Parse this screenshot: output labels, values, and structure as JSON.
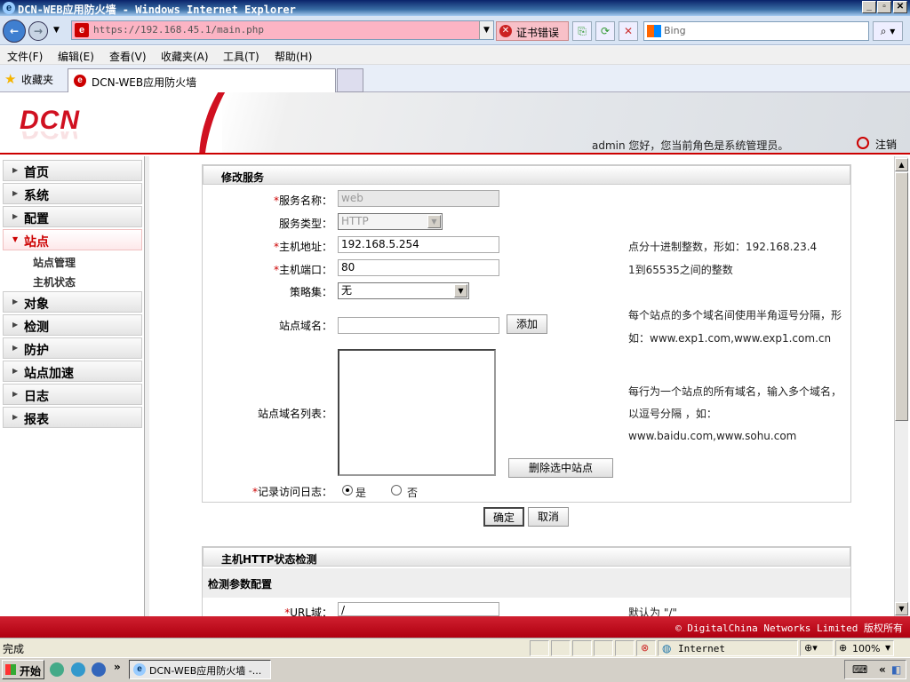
{
  "browser": {
    "window_title": "DCN-WEB应用防火墙 - Windows Internet Explorer",
    "address": "https://192.168.45.1/main.php",
    "cert_error": "证书错误",
    "search_placeholder": "Bing",
    "menu": [
      "文件(F)",
      "编辑(E)",
      "查看(V)",
      "收藏夹(A)",
      "工具(T)",
      "帮助(H)"
    ],
    "favorites_label": "收藏夹",
    "tab_title": "DCN-WEB应用防火墙",
    "status_text": "完成",
    "zone": "Internet",
    "zoom": "100%"
  },
  "header": {
    "logo": "DCN",
    "user_greeting": "admin 您好，您当前角色是系统管理员。",
    "logout": "注销"
  },
  "sidebar": {
    "items": [
      {
        "label": "首页"
      },
      {
        "label": "系统"
      },
      {
        "label": "配置"
      },
      {
        "label": "站点"
      },
      {
        "label": "对象"
      },
      {
        "label": "检测"
      },
      {
        "label": "防护"
      },
      {
        "label": "站点加速"
      },
      {
        "label": "日志"
      },
      {
        "label": "报表"
      }
    ],
    "subitems": [
      "站点管理",
      "主机状态"
    ]
  },
  "form": {
    "section_title": "修改服务",
    "service_name_label": "服务名称：",
    "service_name_value": "web",
    "service_type_label": "服务类型：",
    "service_type_value": "HTTP",
    "host_addr_label": "主机地址：",
    "host_addr_value": "192.168.5.254",
    "host_addr_hint": "点分十进制整数，形如：192.168.23.4",
    "host_port_label": "主机端口：",
    "host_port_value": "80",
    "host_port_hint": "1到65535之间的整数",
    "policy_label": "策略集：",
    "policy_value": "无",
    "domain_label": "站点域名：",
    "add_button": "添加",
    "domain_hint_1": "每个站点的多个域名间使用半角逗号分隔，形",
    "domain_hint_2": "如：www.exp1.com,www.exp1.com.cn",
    "domain_list_label": "站点域名列表：",
    "domain_list_hint_1": "每行为一个站点的所有域名，输入多个域名，",
    "domain_list_hint_2": "以逗号分隔 ，如：",
    "domain_list_hint_3": "www.baidu.com,www.sohu.com",
    "delete_button": "删除选中站点",
    "log_label": "记录访问日志：",
    "log_yes": "是",
    "log_no": "否",
    "ok_button": "确定",
    "cancel_button": "取消"
  },
  "health": {
    "section_title": "主机HTTP状态检测",
    "subsection_title": "检测参数配置",
    "url_label": "URL域：",
    "url_value": "/",
    "url_hint": "默认为 \"/\""
  },
  "footer": {
    "copyright": "© DigitalChina Networks Limited 版权所有"
  },
  "taskbar": {
    "start": "开始",
    "task_item": "DCN-WEB应用防火墙 -..."
  }
}
